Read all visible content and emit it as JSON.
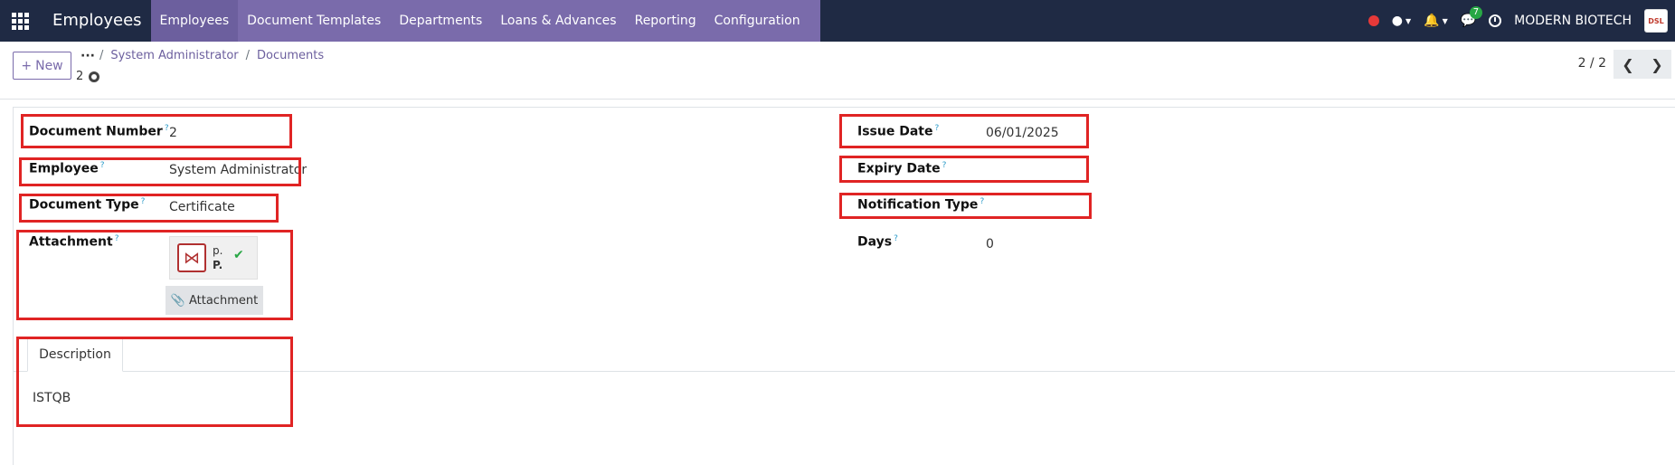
{
  "navbar": {
    "app_name": "Employees",
    "menu": [
      "Employees",
      "Document Templates",
      "Departments",
      "Loans & Advances",
      "Reporting",
      "Configuration"
    ],
    "chat_count": "7",
    "company": "MODERN BIOTECH",
    "company_logo_text": "DSL"
  },
  "control": {
    "new_label": "New",
    "breadcrumb": [
      "System Administrator",
      "Documents"
    ],
    "record_name": "2",
    "pager": "2 / 2"
  },
  "form": {
    "document_number": {
      "label": "Document Number",
      "value": "2"
    },
    "employee": {
      "label": "Employee",
      "value": "System Administrator"
    },
    "document_type": {
      "label": "Document Type",
      "value": "Certificate"
    },
    "attachment": {
      "label": "Attachment",
      "file_name": "p.",
      "file_ext": "P.",
      "button": "Attachment"
    },
    "issue_date": {
      "label": "Issue Date",
      "value": "06/01/2025"
    },
    "expiry_date": {
      "label": "Expiry Date",
      "value": ""
    },
    "notification_type": {
      "label": "Notification Type",
      "value": ""
    },
    "days": {
      "label": "Days",
      "value": "0"
    },
    "help_mark": "?"
  },
  "tabs": {
    "description": {
      "label": "Description",
      "content": "ISTQB"
    }
  },
  "colors": {
    "navbar_bg": "#1f2a44",
    "menu_bg": "#7a6bab",
    "highlight": "#e02424"
  }
}
